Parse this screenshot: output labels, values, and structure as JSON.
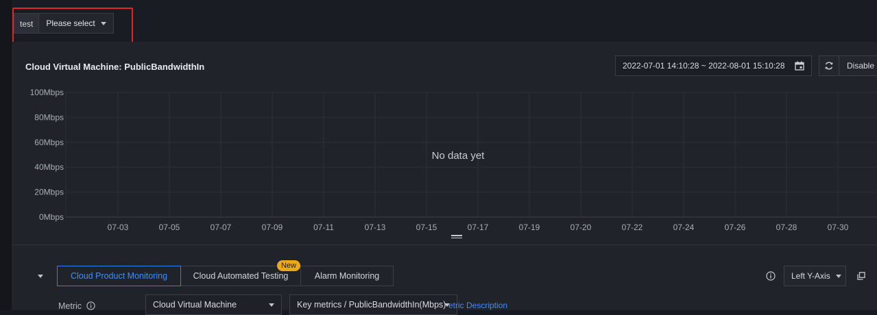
{
  "variable": {
    "label": "test",
    "value": "Please select"
  },
  "panel": {
    "title": "Cloud Virtual Machine: PublicBandwidthIn",
    "date_range": "2022-07-01 14:10:28 ~ 2022-08-01 15:10:28",
    "disable_label": "Disable"
  },
  "chart_data": {
    "type": "line",
    "y_ticks": [
      "100Mbps",
      "80Mbps",
      "60Mbps",
      "40Mbps",
      "20Mbps",
      "0Mbps"
    ],
    "x_ticks": [
      "07-03",
      "07-05",
      "07-07",
      "07-09",
      "07-11",
      "07-13",
      "07-15",
      "07-17",
      "07-19",
      "07-20",
      "07-22",
      "07-24",
      "07-26",
      "07-28",
      "07-30"
    ],
    "ylim": [
      0,
      100
    ],
    "grid": true,
    "series": [],
    "empty_text": "No data yet"
  },
  "tabs": [
    {
      "label": "Cloud Product Monitoring",
      "active": true
    },
    {
      "label": "Cloud Automated Testing",
      "badge": "New"
    },
    {
      "label": "Alarm Monitoring"
    }
  ],
  "y_axis_select": "Left Y-Axis",
  "metric": {
    "label": "Metric",
    "product_select": "Cloud Virtual Machine",
    "metric_select": "Key metrics / PublicBandwidthIn(Mbps)",
    "description_link": "etric Description"
  },
  "colors": {
    "accent": "#2d7ff2",
    "badge": "#e9a81d",
    "highlight_box": "#e0262b"
  }
}
